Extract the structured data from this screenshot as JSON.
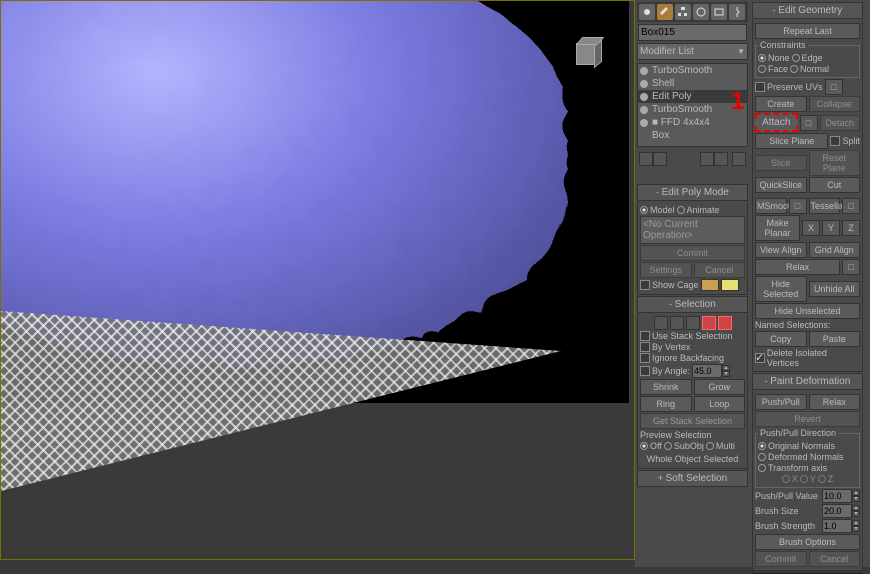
{
  "viewport": {
    "nav_cube": "viewcube"
  },
  "modify": {
    "icons": [
      "create",
      "modify",
      "hierarchy",
      "motion",
      "display",
      "utils"
    ],
    "object_name": "Box015",
    "modifier_list": "Modifier List",
    "stack": [
      {
        "label": "TurboSmooth",
        "sel": false
      },
      {
        "label": "Shell",
        "sel": false
      },
      {
        "label": "Edit Poly",
        "sel": true
      },
      {
        "label": "TurboSmooth",
        "sel": false
      },
      {
        "label": "■ FFD 4x4x4",
        "sel": false
      },
      {
        "label": "Box",
        "sel": false
      }
    ],
    "edit_poly_mode": {
      "title": "Edit Poly Mode",
      "model": "Model",
      "animate": "Animate",
      "no_op": "<No Current Operation>",
      "commit": "Commit",
      "settings": "Settings",
      "cancel": "Cancel",
      "show_cage": "Show Cage"
    },
    "selection": {
      "title": "Selection",
      "use_stack": "Use Stack Selection",
      "by_vertex": "By Vertex",
      "ignore_backfacing": "Ignore Backfacing",
      "by_angle": "By Angle:",
      "angle_val": "45.0",
      "shrink": "Shrink",
      "grow": "Grow",
      "ring": "Ring",
      "loop": "Loop",
      "get_stack": "Get Stack Selection",
      "preview": "Preview Selection",
      "off": "Off",
      "subobj": "SubObj",
      "multi": "Multi",
      "whole": "Whole Object Selected"
    },
    "soft_sel": "Soft Selection"
  },
  "geom": {
    "title": "Edit Geometry",
    "repeat": "Repeat Last",
    "constraints_legend": "Constraints",
    "constraints": {
      "none": "None",
      "edge": "Edge",
      "face": "Face",
      "normal": "Normal"
    },
    "preserve_uvs": "Preserve UVs",
    "create": "Create",
    "collapse": "Collapse",
    "attach": "Attach",
    "detach": "Detach",
    "slice_plane": "Slice Plane",
    "split": "Split",
    "slice": "Slice",
    "reset_plane": "Reset Plane",
    "quickslice": "QuickSlice",
    "cut": "Cut",
    "msmooth": "MSmooth",
    "tessellate": "Tessellate",
    "make_planar": "Make Planar",
    "x": "X",
    "y": "Y",
    "z": "Z",
    "view_align": "View Align",
    "grid_align": "Grid Align",
    "relax": "Relax",
    "hide_sel": "Hide Selected",
    "unhide": "Unhide All",
    "hide_unsel": "Hide Unselected",
    "named_sel": "Named Selections:",
    "copy": "Copy",
    "paste": "Paste",
    "delete_iso": "Delete Isolated Vertices",
    "paint_def": {
      "title": "Paint Deformation",
      "pushpull": "Push/Pull",
      "relax": "Relax",
      "revert": "Revert",
      "dir_legend": "Push/Pull Direction",
      "orig_normals": "Original Normals",
      "deformed": "Deformed Normals",
      "transform_axis": "Transform axis",
      "x": "X",
      "y": "Y",
      "z": "Z",
      "val": "Push/Pull Value",
      "val_v": "10.0",
      "size": "Brush Size",
      "size_v": "20.0",
      "strength": "Brush Strength",
      "strength_v": "1.0",
      "options": "Brush Options",
      "commit": "Commit",
      "cancel": "Cancel"
    }
  },
  "callout": "1"
}
